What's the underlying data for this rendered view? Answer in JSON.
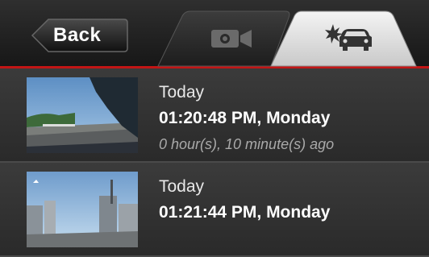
{
  "header": {
    "back_label": "Back",
    "tabs": [
      {
        "icon": "video-camera-icon",
        "active": false
      },
      {
        "icon": "car-crash-icon",
        "active": true
      }
    ],
    "accent": "#c21515"
  },
  "recordings": [
    {
      "day": "Today",
      "time": "01:20:48 PM, Monday",
      "ago": "0 hour(s), 10 minute(s) ago"
    },
    {
      "day": "Today",
      "time": "01:21:44 PM, Monday",
      "ago": ""
    }
  ]
}
